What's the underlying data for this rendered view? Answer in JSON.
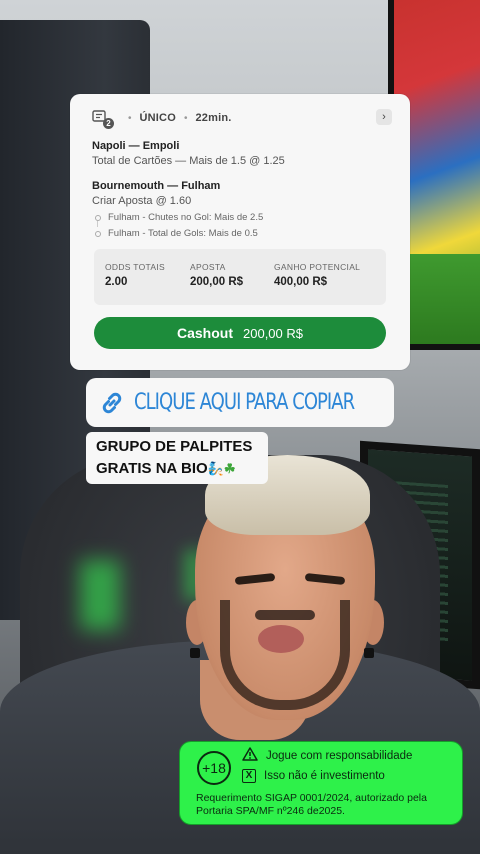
{
  "bet": {
    "ticket_count": "2",
    "type": "ÚNICO",
    "time": "22min.",
    "chevron": "›",
    "match1": {
      "teams": "Napoli — Empoli",
      "market": "Total de Cartões — Mais de 1.5 @ 1.25"
    },
    "match2": {
      "teams": "Bournemouth — Fulham",
      "market": "Criar Aposta @ 1.60",
      "legs": [
        "Fulham - Chutes no Gol: Mais de 2.5",
        "Fulham - Total de Gols: Mais de 0.5"
      ]
    },
    "totals": {
      "odds_label": "ODDS TOTAIS",
      "odds_value": "2.00",
      "stake_label": "APOSTA",
      "stake_value": "200,00 R$",
      "win_label": "GANHO POTENCIAL",
      "win_value": "400,00 R$"
    },
    "cashout_label": "Cashout",
    "cashout_amount": "200,00 R$"
  },
  "copy_banner": {
    "text": "CLIQUE AQUI PARA COPIAR"
  },
  "group_label": {
    "line1": "GRUPO DE PALPITES",
    "line2": "GRATIS NA BIO"
  },
  "disclaimer": {
    "age": "+18",
    "warning1": "Jogue com responsabilidade",
    "warning2": "Isso não é investimento",
    "x_glyph": "X",
    "legal": "Requerimento SIGAP 0001/2024, autorizado pela Portaria SPA/MF nº246 de2025."
  },
  "colors": {
    "cashout_green": "#1d8c3b",
    "link_blue": "#2d86d6",
    "disclaimer_green": "#2ef14a"
  }
}
